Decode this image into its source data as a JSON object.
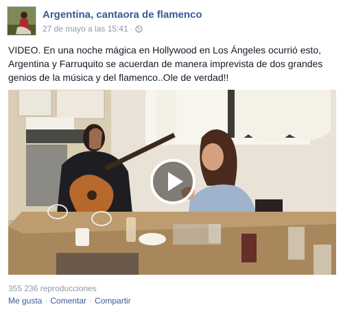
{
  "post": {
    "page_name": "Argentina, cantaora de flamenco",
    "timestamp": "27 de mayo a las 15:41",
    "separator": "·",
    "privacy_icon": "globe-icon",
    "text": "VIDEO. En una noche mágica en Hollywood en Los Ángeles ocurrió esto, Argentina y Farruquito se acuerdan de manera imprevista de dos grandes genios de la música y del flamenco..Ole de verdad!!"
  },
  "video": {
    "play_icon": "play-icon",
    "views": "355 236 reproducciones"
  },
  "actions": {
    "like_label": "Me gusta",
    "comment_label": "Comentar",
    "share_label": "Compartir",
    "separator": "·"
  },
  "colors": {
    "link": "#3b5998",
    "meta": "#9197a3",
    "text": "#141823"
  }
}
